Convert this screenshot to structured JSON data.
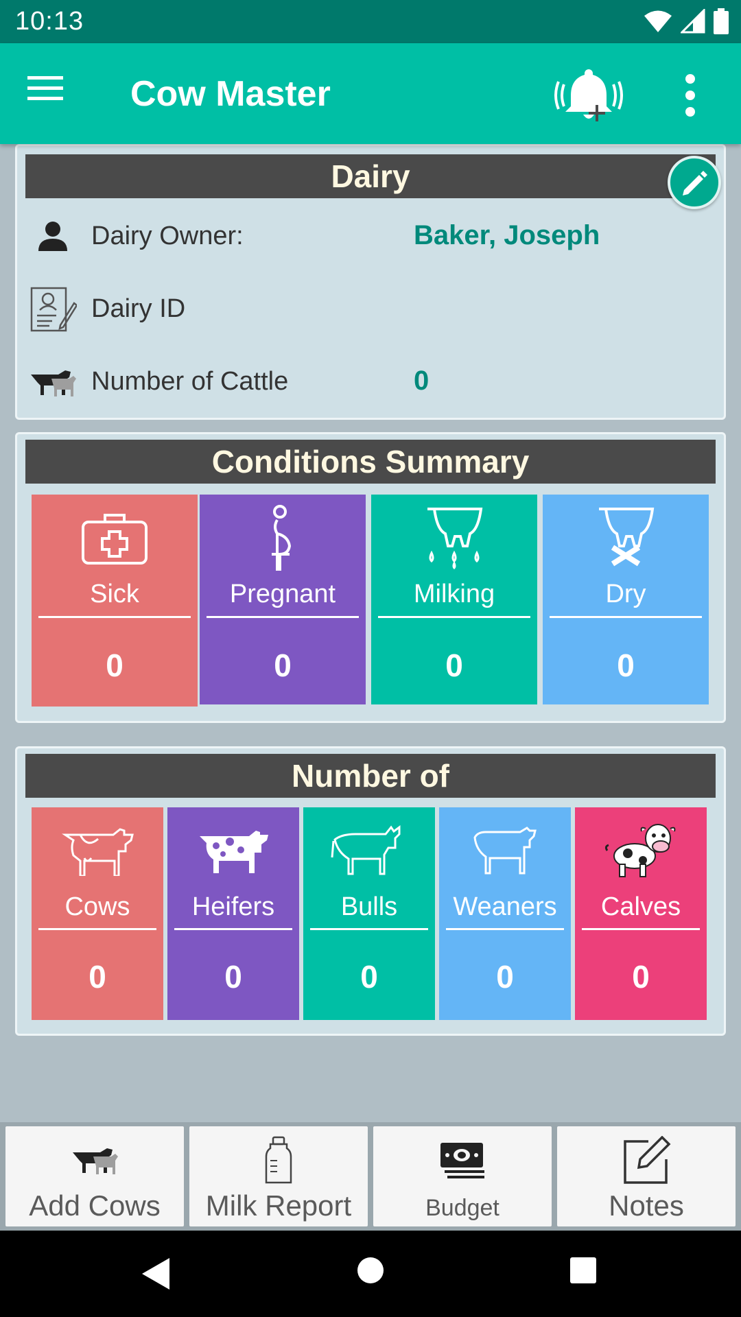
{
  "status_bar": {
    "time": "10:13"
  },
  "app_bar": {
    "title": "Cow Master"
  },
  "dairy": {
    "header": "Dairy",
    "owner_label": "Dairy Owner:",
    "owner_value": "Baker, Joseph",
    "id_label": "Dairy ID",
    "id_value": "",
    "cattle_label": "Number of Cattle",
    "cattle_value": "0"
  },
  "conditions": {
    "header": "Conditions Summary",
    "tiles": [
      {
        "label": "Sick",
        "count": "0",
        "color": "#e57373",
        "icon": "first-aid-kit-icon"
      },
      {
        "label": "Pregnant",
        "count": "0",
        "color": "#7e57c2",
        "icon": "pregnant-icon"
      },
      {
        "label": "Milking",
        "count": "0",
        "color": "#00bfa5",
        "icon": "udder-milk-icon"
      },
      {
        "label": "Dry",
        "count": "0",
        "color": "#64b5f6",
        "icon": "udder-dry-icon"
      }
    ]
  },
  "number_of": {
    "header": "Number of",
    "tiles": [
      {
        "label": "Cows",
        "count": "0",
        "color": "#e57373",
        "icon": "cow-icon"
      },
      {
        "label": "Heifers",
        "count": "0",
        "color": "#7e57c2",
        "icon": "heifer-icon"
      },
      {
        "label": "Bulls",
        "count": "0",
        "color": "#00bfa5",
        "icon": "bull-icon"
      },
      {
        "label": "Weaners",
        "count": "0",
        "color": "#64b5f6",
        "icon": "weaner-icon"
      },
      {
        "label": "Calves",
        "count": "0",
        "color": "#ec407a",
        "icon": "calf-icon"
      }
    ]
  },
  "bottom_nav": {
    "items": [
      {
        "label": "Add Cows",
        "icon": "cattle-icon"
      },
      {
        "label": "Milk Report",
        "icon": "milk-bottle-icon"
      },
      {
        "label": "Budget",
        "icon": "money-icon"
      },
      {
        "label": "Notes",
        "icon": "notes-edit-icon"
      }
    ]
  }
}
